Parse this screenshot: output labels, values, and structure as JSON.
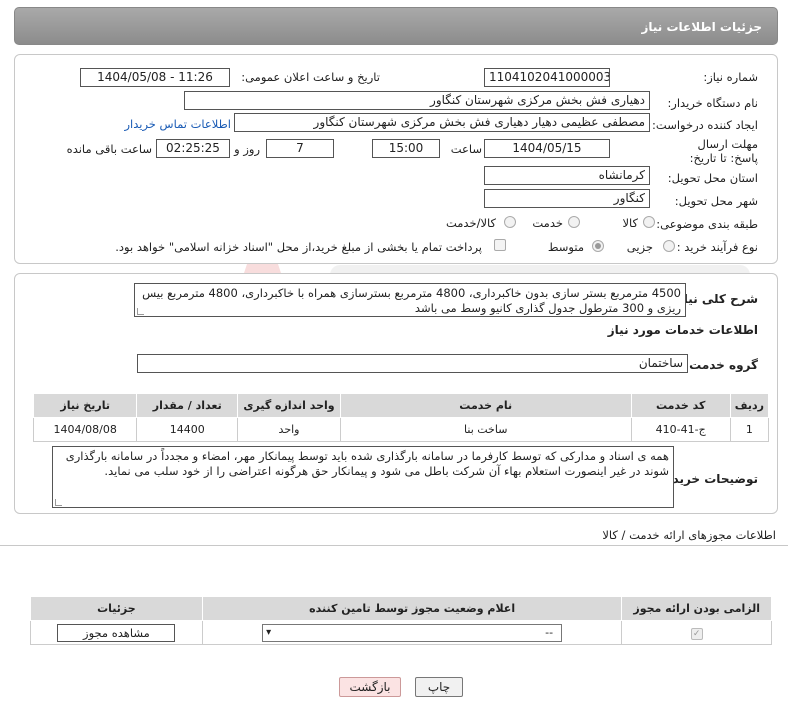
{
  "header": {
    "title": "جزئیات اطلاعات نیاز"
  },
  "fields": {
    "need_number_label": "شماره نیاز:",
    "need_number": "1104102041000003",
    "announce_label": "تاریخ و ساعت اعلان عمومی:",
    "announce_value": "1404/05/08 - 11:26",
    "buyer_org_label": "نام دستگاه خریدار:",
    "buyer_org": "دهیاری فش بخش مرکزی شهرستان کنگاور",
    "requester_label": "ایجاد کننده درخواست:",
    "requester": "مصطفی عظیمی دهیار دهیاری فش بخش مرکزی شهرستان کنگاور",
    "contact_link": "اطلاعات تماس خریدار",
    "deadline_label": "مهلت ارسال پاسخ: تا تاریخ:",
    "deadline_date": "1404/05/15",
    "time_label": "ساعت",
    "deadline_time": "15:00",
    "days_value": "7",
    "days_label": "روز و",
    "remaining_time": "02:25:25",
    "remaining_label": "ساعت باقی مانده",
    "province_label": "استان محل تحویل:",
    "province": "کرمانشاه",
    "city_label": "شهر محل تحویل:",
    "city": "کنگاور",
    "category_label": "طبقه بندی موضوعی:",
    "category_options": [
      "کالا",
      "خدمت",
      "کالا/خدمت"
    ],
    "purchase_type_label": "نوع فرآیند خرید :",
    "purchase_type_options": [
      "جزیی",
      "متوسط"
    ],
    "treasury_note": "پرداخت تمام یا بخشی از مبلغ خرید،از محل \"اسناد خزانه اسلامی\" خواهد بود."
  },
  "summary": {
    "label": "شرح کلی نیاز:",
    "text": "4500 مترمربع بستر سازی بدون خاکبرداری، 4800 مترمربع بسترسازی همراه با خاکبرداری، 4800 مترمربع بیس ریزی و 300 مترطول جدول گذاری کانیو وسط می باشد"
  },
  "services": {
    "section_title": "اطلاعات خدمات مورد نیاز",
    "group_label": "گروه خدمت:",
    "group_value": "ساختمان",
    "columns": [
      "ردیف",
      "کد خدمت",
      "نام خدمت",
      "واحد اندازه گیری",
      "تعداد / مقدار",
      "تاریخ نیاز"
    ],
    "rows": [
      [
        "1",
        "ج-41-410",
        "ساخت بنا",
        "واحد",
        "14400",
        "1404/08/08"
      ]
    ]
  },
  "buyer_notes": {
    "label": "توضیحات خریدار:",
    "text": "همه ی اسناد و مدارکی که توسط کارفرما در سامانه بارگذاری شده باید توسط پیمانکار مهر، امضاء و مجدداً در سامانه بارگذاری شوند در غیر اینصورت استعلام بهاء آن شرکت باطل می شود و پیمانکار حق هرگونه اعتراضی را از خود سلب می نماید."
  },
  "permits": {
    "section_title": "اطلاعات مجوزهای ارائه خدمت / کالا",
    "columns": [
      "الزامی بودن ارائه مجوز",
      "اعلام وضعیت مجوز توسط تامین کننده",
      "جزئیات"
    ],
    "select_value": "--",
    "view_button": "مشاهده مجوز"
  },
  "actions": {
    "print": "چاپ",
    "back": "بازگشت"
  }
}
